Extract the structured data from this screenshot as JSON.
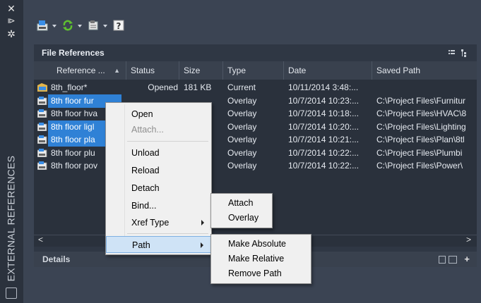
{
  "palette": {
    "vertical_title": "EXTERNAL REFERENCES",
    "panel_title": "File References",
    "details_title": "Details"
  },
  "columns": [
    "Reference ...",
    "Status",
    "Size",
    "Type",
    "Date",
    "Saved Path"
  ],
  "sort_column": "Reference ...",
  "rows": [
    {
      "name": "8th_floor*",
      "status": "Opened",
      "size": "181 KB",
      "type": "Current",
      "date": "10/11/2014 3:48:...",
      "path": "",
      "icon": "dwg-current-icon",
      "selected": false
    },
    {
      "name": "8th floor fur",
      "status": "",
      "size": "",
      "type": "Overlay",
      "date": "10/7/2014 10:23:...",
      "path": "C:\\Project Files\\Furnitur",
      "icon": "dwg-xref-icon",
      "selected": true
    },
    {
      "name": "8th floor hva",
      "status": "",
      "size": "",
      "type": "Overlay",
      "date": "10/7/2014 10:18:...",
      "path": "C:\\Project Files\\HVAC\\8",
      "icon": "dwg-xref-icon",
      "selected": false
    },
    {
      "name": "8th floor ligl",
      "status": "",
      "size": "",
      "type": "Overlay",
      "date": "10/7/2014 10:20:...",
      "path": "C:\\Project Files\\Lighting",
      "icon": "dwg-xref-icon",
      "selected": true
    },
    {
      "name": "8th floor pla",
      "status": "",
      "size": "",
      "type": "Overlay",
      "date": "10/7/2014 10:21:...",
      "path": "C:\\Project Files\\Plan\\8tl",
      "icon": "dwg-xref-icon",
      "selected": true
    },
    {
      "name": "8th floor plu",
      "status": "",
      "size": "",
      "type": "Overlay",
      "date": "10/7/2014 10:22:...",
      "path": "C:\\Project Files\\Plumbi",
      "icon": "dwg-xref-icon",
      "selected": false
    },
    {
      "name": "8th floor pov",
      "status": "",
      "size": "",
      "type": "Overlay",
      "date": "10/7/2014 10:22:...",
      "path": "C:\\Project Files\\Power\\",
      "icon": "dwg-xref-icon",
      "selected": false
    }
  ],
  "context_menu": {
    "items": [
      {
        "label": "Open",
        "enabled": true
      },
      {
        "label": "Attach...",
        "enabled": false
      },
      {
        "label": "Unload",
        "enabled": true
      },
      {
        "label": "Reload",
        "enabled": true
      },
      {
        "label": "Detach",
        "enabled": true
      },
      {
        "label": "Bind...",
        "enabled": true
      },
      {
        "label": "Xref Type",
        "enabled": true
      },
      {
        "label": "Path",
        "enabled": true
      }
    ]
  },
  "xref_type_submenu": [
    "Attach",
    "Overlay"
  ],
  "path_submenu": [
    "Make Absolute",
    "Make Relative",
    "Remove Path"
  ],
  "colors": {
    "selection": "#2f81d6",
    "palette_bg": "#3b4453",
    "menu_bg": "#f0f0f0"
  }
}
